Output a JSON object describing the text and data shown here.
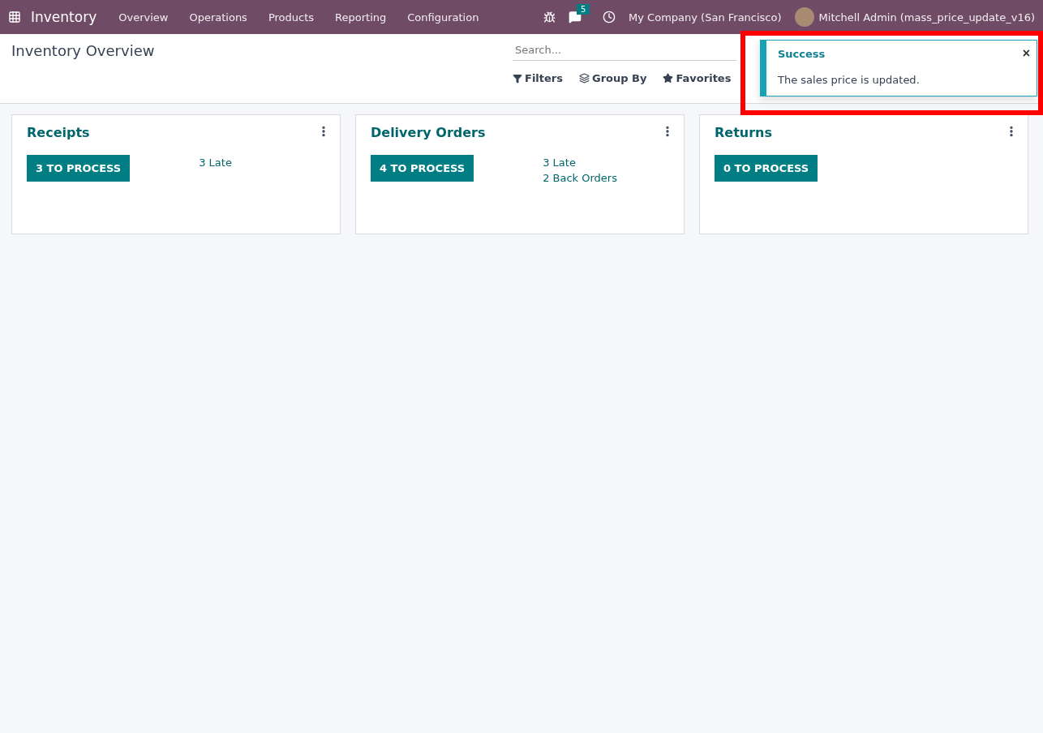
{
  "navbar": {
    "app": "Inventory",
    "menus": [
      "Overview",
      "Operations",
      "Products",
      "Reporting",
      "Configuration"
    ],
    "messages_badge": "5",
    "company": "My Company (San Francisco)",
    "user": "Mitchell Admin (mass_price_update_v16)"
  },
  "control_panel": {
    "title": "Inventory Overview",
    "search": {
      "placeholder": "Search..."
    },
    "buttons": [
      {
        "kind": "filter",
        "label": "Filters"
      },
      {
        "kind": "group",
        "label": "Group By"
      },
      {
        "kind": "favorite",
        "label": "Favorites"
      }
    ]
  },
  "cards": [
    {
      "title": "Receipts",
      "action": "3 TO PROCESS",
      "links": [
        "3 Late"
      ]
    },
    {
      "title": "Delivery Orders",
      "action": "4 TO PROCESS",
      "links": [
        "3 Late",
        "2 Back Orders"
      ]
    },
    {
      "title": "Returns",
      "action": "0 TO PROCESS"
    }
  ],
  "notification": {
    "title": "Success",
    "message": "The sales price is updated.",
    "close": "×",
    "highlighted": true
  }
}
